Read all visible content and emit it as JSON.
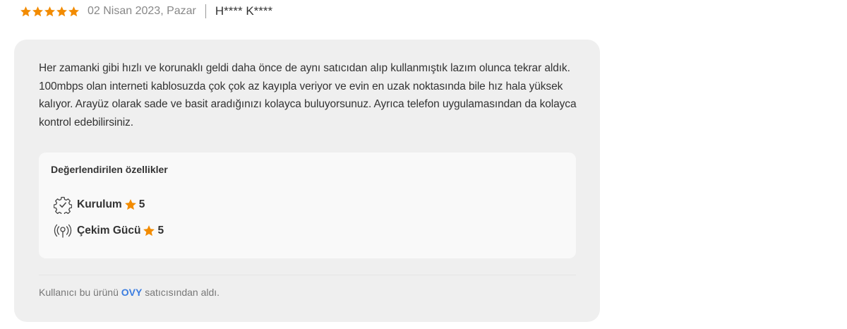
{
  "review": {
    "rating": 5,
    "rating_max": 5,
    "date": "02 Nisan 2023, Pazar",
    "author": "H**** K****",
    "text": "Her zamanki gibi hızlı ve korunaklı geldi daha önce de aynı satıcıdan alıp kullanmıştık lazım olunca tekrar aldık. 100mbps olan interneti kablosuzda çok çok az kayıpla veriyor ve evin en uzak noktasında bile hız hala yüksek kalıyor. Arayüz olarak sade ve basit aradığınızı kolayca buluyorsunuz. Ayrıca telefon uygulamasından da kolayca kontrol edebilirsiniz."
  },
  "features": {
    "title": "Değerlendirilen özellikler",
    "items": [
      {
        "icon": "gear-check-icon",
        "label": "Kurulum",
        "score": "5"
      },
      {
        "icon": "signal-antenna-icon",
        "label": "Çekim Gücü",
        "score": "5"
      }
    ]
  },
  "seller": {
    "prefix": "Kullanıcı bu ürünü",
    "name": "OVY",
    "suffix": "satıcısından aldı."
  },
  "colors": {
    "star": "#f28b00",
    "link": "#3b7de0",
    "card_bg": "#efefef",
    "features_bg": "#f9f9f9"
  }
}
